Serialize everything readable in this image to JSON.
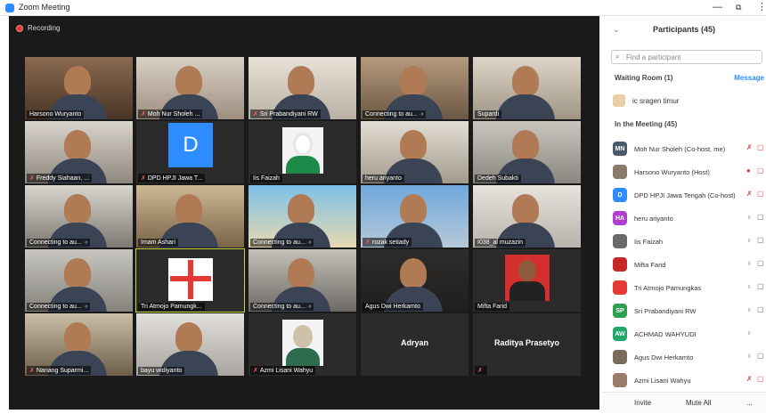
{
  "window": {
    "title": "Zoom Meeting",
    "minimize": "—",
    "restore": "⧉",
    "more": "⋮"
  },
  "recording": {
    "label": "Recording",
    "color": "#e53935"
  },
  "tiles": [
    {
      "name": "Harsono Wuryanto",
      "muted": false
    },
    {
      "name": "Moh Nur Sholeh ...",
      "muted": true
    },
    {
      "name": "Sri Prabandiyani RW",
      "muted": true
    },
    {
      "name": "Connecting to au... ·›",
      "muted": false
    },
    {
      "name": "Supardi",
      "muted": false
    },
    {
      "name": "Freddy Siahaan, ...",
      "muted": true
    },
    {
      "name": "DPD HPJI Jawa T...",
      "muted": true,
      "avatar_letter": "D"
    },
    {
      "name": "Iis Faizah",
      "muted": false
    },
    {
      "name": "heru ariyanto",
      "muted": false
    },
    {
      "name": "Dedeh Subakti",
      "muted": false
    },
    {
      "name": "Connecting to au... ·›",
      "muted": false
    },
    {
      "name": "Imam Ashari",
      "muted": false
    },
    {
      "name": "Connecting to au... ·›",
      "muted": false
    },
    {
      "name": "rozak setiady",
      "muted": true
    },
    {
      "name": "I038_al muzazin",
      "muted": false
    },
    {
      "name": "Connecting to au... ·›",
      "muted": false
    },
    {
      "name": "Tri Atmojo Pamungk...",
      "muted": false,
      "active": true
    },
    {
      "name": "Connecting to au... ·›",
      "muted": false
    },
    {
      "name": "Agus Dwi Herkamto",
      "muted": false
    },
    {
      "name": "Mifta Farid",
      "muted": false
    },
    {
      "name": "Nanang Suparmi...",
      "muted": true
    },
    {
      "name": "bayu widiyanto",
      "muted": false
    },
    {
      "name": "Azmi Lisani Wahyu",
      "muted": true
    },
    {
      "name": "",
      "muted": false,
      "big_name": "Adryan"
    },
    {
      "name": "",
      "muted": true,
      "big_name": "Raditya Prasetyo"
    }
  ],
  "panel": {
    "title": "Participants (45)",
    "search_placeholder": "Find a participant",
    "waiting_room_label": "Waiting Room (1)",
    "message_label": "Message",
    "waiting": [
      {
        "name": "ic sragen timur"
      }
    ],
    "in_meeting_label": "In the Meeting (45)",
    "participants": [
      {
        "name": "Moh Nur Sholeh (Co-host, me)",
        "initials": "MN",
        "color": "#4a5a6a"
      },
      {
        "name": "Harsono Wuryanto (Host)",
        "initials": "",
        "color": "#8a7a6a"
      },
      {
        "name": "DPD HPJI Jawa Tengah (Co-host)",
        "initials": "D",
        "color": "#2d8cff"
      },
      {
        "name": "heru ariyanto",
        "initials": "HA",
        "color": "#b03fd0"
      },
      {
        "name": "Iis Faizah",
        "initials": "",
        "color": "#6a6a6a"
      },
      {
        "name": "Mifta Farid",
        "initials": "",
        "color": "#c62828"
      },
      {
        "name": "Tri Atmojo Pamungkas",
        "initials": "",
        "color": "#e53935"
      },
      {
        "name": "Sri Prabandiyani RW",
        "initials": "SP",
        "color": "#2e9e4f"
      },
      {
        "name": "ACHMAD WAHYUDI",
        "initials": "AW",
        "color": "#23a86a"
      },
      {
        "name": "Agus Dwi Herkamto",
        "initials": "",
        "color": "#7a6a5a"
      },
      {
        "name": "Azmi Lisani Wahyu",
        "initials": "",
        "color": "#9a7a6a"
      }
    ],
    "invite_label": "Invite",
    "mute_all_label": "Mute All",
    "more_label": "..."
  }
}
